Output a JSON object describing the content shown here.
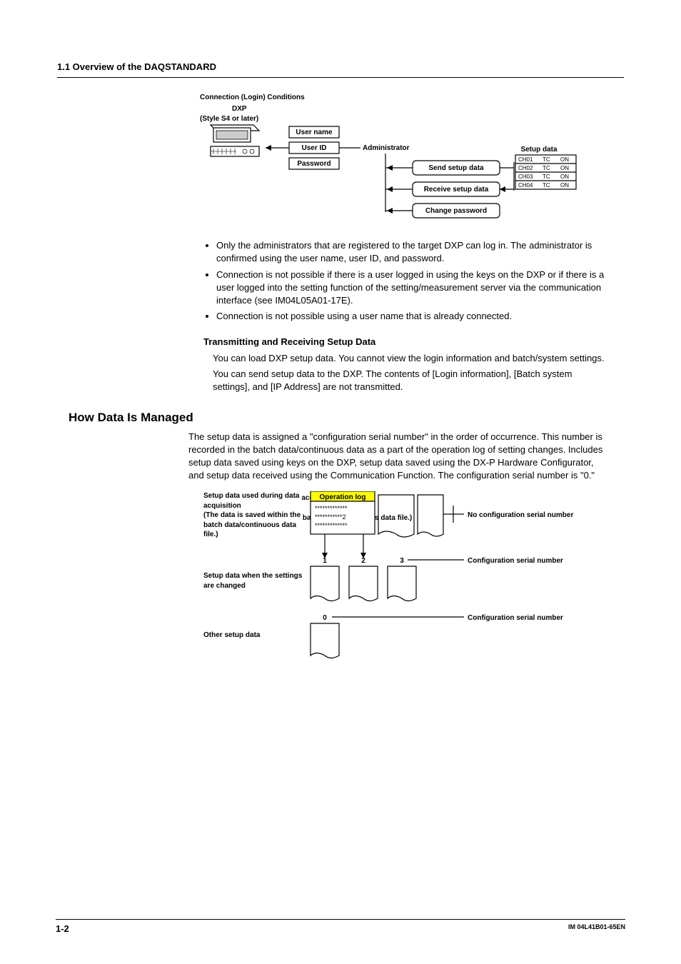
{
  "header": {
    "title": "1.1  Overview of the DAQSTANDARD"
  },
  "fig1": {
    "title": "Connection (Login) Conditions",
    "device_label1": "DXP",
    "device_label2": "(Style S4 or later)",
    "cred_rows": [
      "User name",
      "User ID",
      "Password"
    ],
    "admin_label": "Administrator",
    "action1": "Send setup data",
    "action2": "Receive setup data",
    "action3": "Change password",
    "setup_header": "Setup data",
    "setup_rows": [
      [
        "CH01",
        "TC",
        "ON"
      ],
      [
        "CH02",
        "TC",
        "ON"
      ],
      [
        "CH03",
        "TC",
        "ON"
      ],
      [
        "CH04",
        "TC",
        "ON"
      ]
    ]
  },
  "bullets": [
    "Only the administrators that are registered to the target DXP can log in. The administrator is confirmed using the user name, user ID, and password.",
    "Connection is not possible if there is a user logged in using the keys on the DXP or if there is a user logged into the setting function of the setting/measurement server via the communication interface (see IM04L05A01-17E).",
    "Connection is not possible using a user name that is already connected."
  ],
  "trx": {
    "title": "Transmitting and Receiving Setup Data",
    "p1": "You can load DXP setup data. You cannot view the login information and batch/system settings.",
    "p2": "You can send setup data to the DXP. The contents of [Login information], [Batch system settings], and [IP Address] are not transmitted."
  },
  "manage": {
    "title": "How Data Is Managed",
    "p": "The setup data is assigned a \"configuration serial number\" in the order of occurrence. This number is recorded in the batch data/continuous data as a part of the operation log of setting changes.  Includes setup data saved using keys on the DXP, setup data saved using the DX-P Hardware Configurator, and setup data received using the Communication Function. The configuration serial number is \"0.\""
  },
  "fig2": {
    "left1": "Setup data used during data acquisition",
    "left1b": "(The data is saved within the batch data/continuous data file.)",
    "left2": "Setup data when the settings are changed",
    "left3": "Other setup data",
    "oplog": "Operation log",
    "logtxt1": "*************",
    "logtxt2": "***********2",
    "logtxt3": "*************",
    "n1": "1",
    "n2": "2",
    "n3": "3",
    "n0": "0",
    "r1": "No configuration serial number",
    "r2": "Configuration serial number",
    "r3": "Configuration serial number"
  },
  "footer": {
    "page": "1-2",
    "docid": "IM  04L41B01-65EN"
  }
}
